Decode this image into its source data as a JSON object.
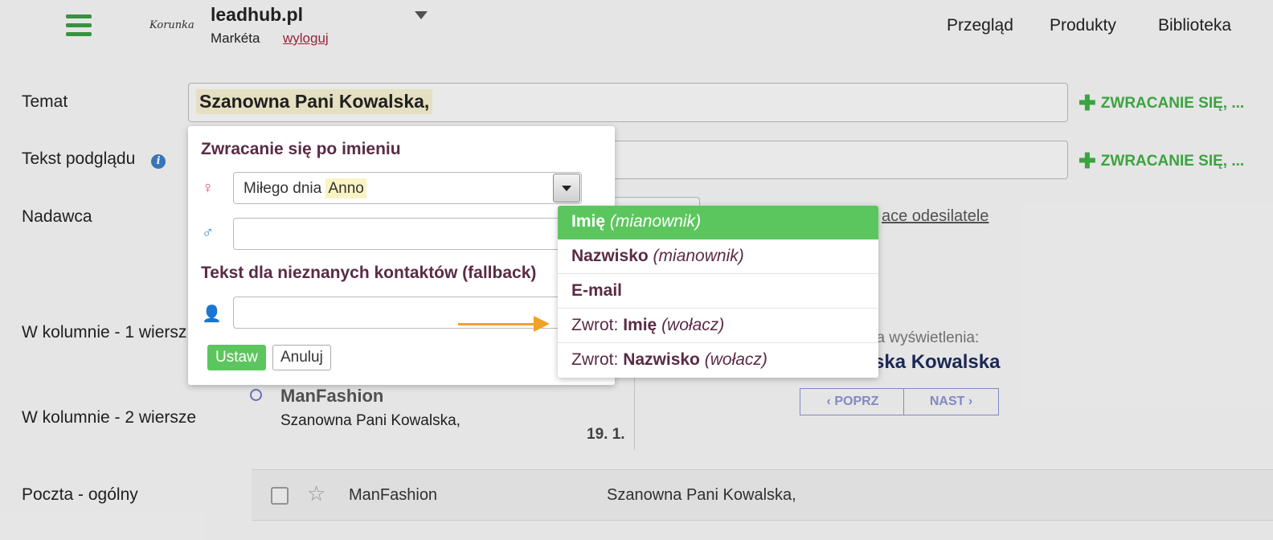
{
  "header": {
    "logo": "Korunka",
    "brand": "leadhub.pl",
    "user": "Markéta",
    "logout": "wyloguj",
    "nav": [
      "Przegląd",
      "Produkty",
      "Biblioteka"
    ]
  },
  "form": {
    "subject_label": "Temat",
    "subject_value": "Szanowna Pani Kowalska,",
    "preview_label": "Tekst podglądu",
    "sender_label": "Nadawca",
    "add_salutation": "ZWRACANIE SIĘ, ...",
    "sender_link_text": "ace odesilatele",
    "layout_1_label": "W kolumnie - 1 wiersz",
    "layout_2_label": "W kolumnie - 2 wiersze",
    "layout_3_label": "Poczta - ogólny"
  },
  "preview": {
    "label": "ka wyświetlenia:",
    "name": "ska Kowalska",
    "prev": "POPRZ",
    "next": "NAST"
  },
  "mail_preview": {
    "from": "ManFashion",
    "subject": "Szanowna Pani Kowalska,",
    "date": "19. 1."
  },
  "mail_row": {
    "from": "ManFashion",
    "subject": "Szanowna Pani Kowalska,"
  },
  "popup": {
    "title": "Zwracanie się po imieniu",
    "female_value_prefix": "Miłego dnia",
    "female_value_highlight": "Anno",
    "male_value": "",
    "fallback_title": "Tekst dla nieznanych kontaktów (fallback)",
    "fallback_value": "",
    "ok": "Ustaw",
    "cancel": "Anuluj"
  },
  "dropdown": {
    "items": [
      {
        "bold": "Imię",
        "prefix": "",
        "italic": "(mianownik)"
      },
      {
        "bold": "Nazwisko",
        "prefix": "",
        "italic": "(mianownik)"
      },
      {
        "bold": "E-mail",
        "prefix": "",
        "italic": ""
      },
      {
        "bold": "Imię",
        "prefix": "Zwrot:",
        "italic": "(wołacz)"
      },
      {
        "bold": "Nazwisko",
        "prefix": "Zwrot:",
        "italic": "(wołacz)"
      }
    ],
    "selected_index": 0
  },
  "colors": {
    "accent_green": "#5cc65e",
    "title_plum": "#5a2b45",
    "arrow_orange": "#f0a226",
    "link_red": "#a3263d"
  }
}
